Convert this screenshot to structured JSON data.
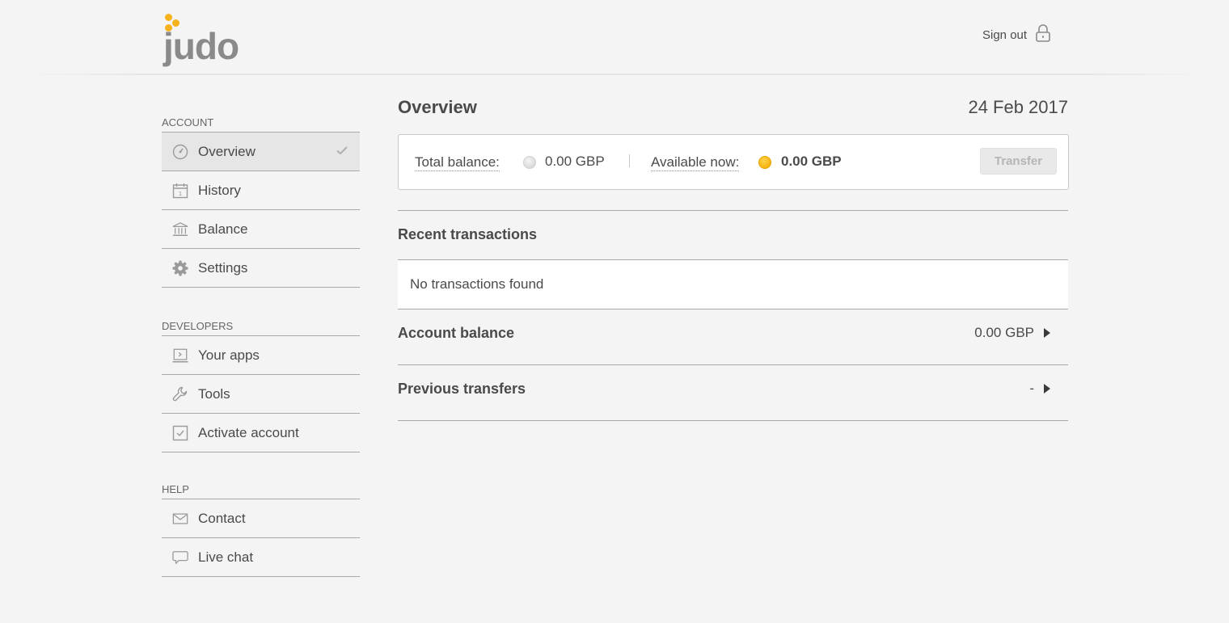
{
  "header": {
    "logo_text": "judo",
    "signout_label": "Sign out"
  },
  "colors": {
    "brand_yellow": "#f6b21b",
    "text": "#4a4a4a",
    "background": "#f4f4f4",
    "divider": "#a9a9a9"
  },
  "sidebar": {
    "sections": [
      {
        "title": "ACCOUNT",
        "items": [
          {
            "label": "Overview",
            "icon": "dashboard-icon",
            "active": true
          },
          {
            "label": "History",
            "icon": "calendar-icon"
          },
          {
            "label": "Balance",
            "icon": "bank-icon"
          },
          {
            "label": "Settings",
            "icon": "gear-icon"
          }
        ]
      },
      {
        "title": "DEVELOPERS",
        "items": [
          {
            "label": "Your apps",
            "icon": "app-window-icon"
          },
          {
            "label": "Tools",
            "icon": "wrench-icon"
          },
          {
            "label": "Activate account",
            "icon": "checkbox-icon"
          }
        ]
      },
      {
        "title": "HELP",
        "items": [
          {
            "label": "Contact",
            "icon": "envelope-icon"
          },
          {
            "label": "Live chat",
            "icon": "chat-bubble-icon"
          }
        ]
      }
    ]
  },
  "main": {
    "title": "Overview",
    "date": "24 Feb 2017",
    "balance": {
      "total_label": "Total balance:",
      "total_value": "0.00 GBP",
      "available_label": "Available now:",
      "available_value": "0.00 GBP",
      "transfer_label": "Transfer"
    },
    "recent": {
      "title": "Recent transactions",
      "empty_text": "No transactions found"
    },
    "account_balance": {
      "title": "Account balance",
      "value": "0.00 GBP"
    },
    "previous_transfers": {
      "title": "Previous transfers",
      "value": "-"
    }
  }
}
